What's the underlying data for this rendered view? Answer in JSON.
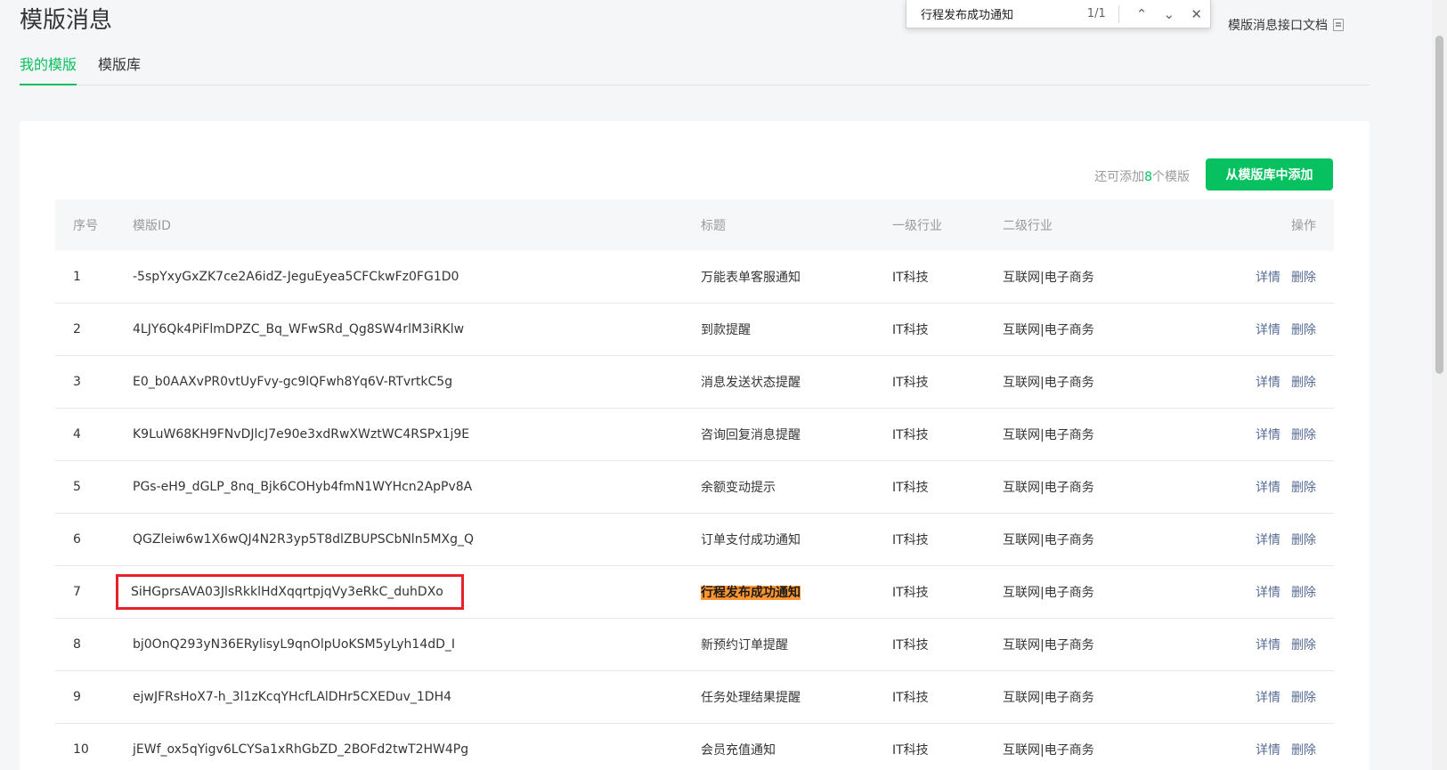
{
  "header": {
    "title": "模版消息",
    "doc_link": "模版消息接口文档"
  },
  "tabs": [
    {
      "label": "我的模版",
      "active": true
    },
    {
      "label": "模版库",
      "active": false
    }
  ],
  "find_bar": {
    "query": "行程发布成功通知",
    "count": "1/1",
    "prev_icon": "⌃",
    "next_icon": "⌄",
    "close_icon": "✕"
  },
  "toolbar": {
    "remain_prefix": "还可添加",
    "remain_count": "8",
    "remain_suffix": "个模版",
    "add_button": "从模版库中添加"
  },
  "table": {
    "headers": {
      "index": "序号",
      "template_id": "模版ID",
      "title": "标题",
      "industry1": "一级行业",
      "industry2": "二级行业",
      "ops": "操作"
    },
    "rows": [
      {
        "index": "1",
        "template_id": "-5spYxyGxZK7ce2A6idZ-JeguEyea5CFCkwFz0FG1D0",
        "title": "万能表单客服通知",
        "industry1": "IT科技",
        "industry2": "互联网|电子商务",
        "detail": "详情",
        "delete": "删除"
      },
      {
        "index": "2",
        "template_id": "4LJY6Qk4PiFlmDPZC_Bq_WFwSRd_Qg8SW4rlM3iRKlw",
        "title": "到款提醒",
        "industry1": "IT科技",
        "industry2": "互联网|电子商务",
        "detail": "详情",
        "delete": "删除"
      },
      {
        "index": "3",
        "template_id": "E0_b0AAXvPR0vtUyFvy-gc9lQFwh8Yq6V-RTvrtkC5g",
        "title": "消息发送状态提醒",
        "industry1": "IT科技",
        "industry2": "互联网|电子商务",
        "detail": "详情",
        "delete": "删除"
      },
      {
        "index": "4",
        "template_id": "K9LuW68KH9FNvDJlcJ7e90e3xdRwXWztWC4RSPx1j9E",
        "title": "咨询回复消息提醒",
        "industry1": "IT科技",
        "industry2": "互联网|电子商务",
        "detail": "详情",
        "delete": "删除"
      },
      {
        "index": "5",
        "template_id": "PGs-eH9_dGLP_8nq_Bjk6COHyb4fmN1WYHcn2ApPv8A",
        "title": "余额变动提示",
        "industry1": "IT科技",
        "industry2": "互联网|电子商务",
        "detail": "详情",
        "delete": "删除"
      },
      {
        "index": "6",
        "template_id": "QGZleiw6w1X6wQJ4N2R3yp5T8dlZBUPSCbNln5MXg_Q",
        "title": "订单支付成功通知",
        "industry1": "IT科技",
        "industry2": "互联网|电子商务",
        "detail": "详情",
        "delete": "删除"
      },
      {
        "index": "7",
        "template_id": "SiHGprsAVA03JlsRkklHdXqqrtpjqVy3eRkC_duhDXo",
        "title": "行程发布成功通知",
        "industry1": "IT科技",
        "industry2": "互联网|电子商务",
        "detail": "详情",
        "delete": "删除"
      },
      {
        "index": "8",
        "template_id": "bj0OnQ293yN36ERylisyL9qnOlpUoKSM5yLyh14dD_I",
        "title": "新预约订单提醒",
        "industry1": "IT科技",
        "industry2": "互联网|电子商务",
        "detail": "详情",
        "delete": "删除"
      },
      {
        "index": "9",
        "template_id": "ejwJFRsHoX7-h_3l1zKcqYHcfLAlDHr5CXEDuv_1DH4",
        "title": "任务处理结果提醒",
        "industry1": "IT科技",
        "industry2": "互联网|电子商务",
        "detail": "详情",
        "delete": "删除"
      },
      {
        "index": "10",
        "template_id": "jEWf_ox5qYigv6LCYSa1xRhGbZD_2BOFd2twT2HW4Pg",
        "title": "会员充值通知",
        "industry1": "IT科技",
        "industry2": "互联网|电子商务",
        "detail": "详情",
        "delete": "删除"
      }
    ]
  },
  "colors": {
    "accent": "#07c160",
    "link": "#576b95",
    "highlight": "#ff9632",
    "annotation_box": "#e8202c"
  }
}
